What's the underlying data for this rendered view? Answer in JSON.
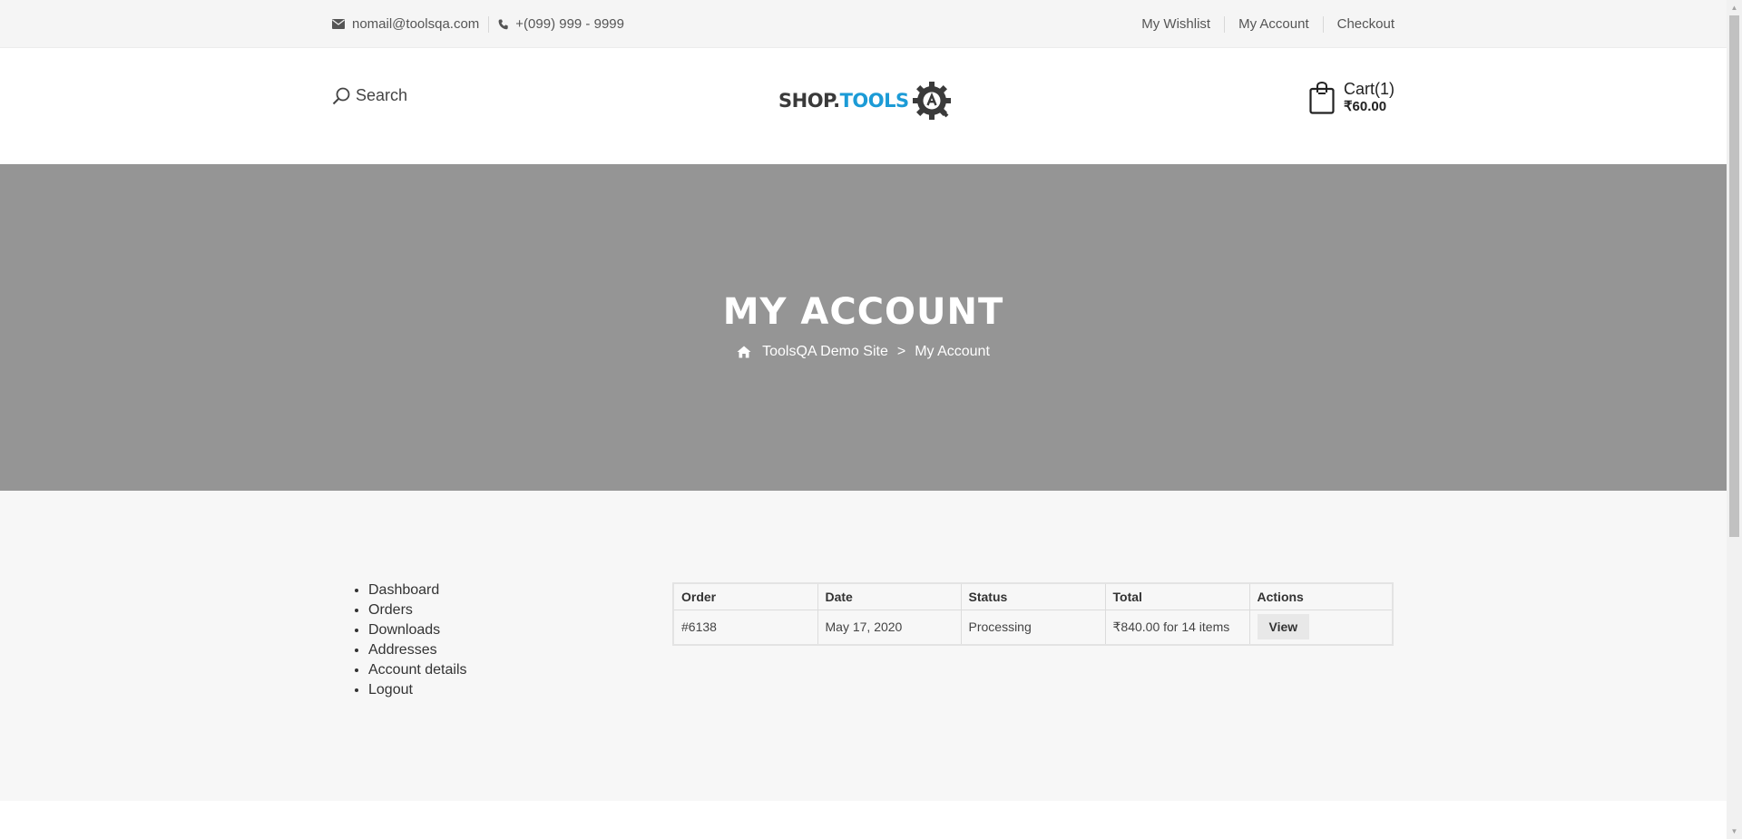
{
  "topbar": {
    "email": "nomail@toolsqa.com",
    "phone": "+(099) 999 - 9999",
    "links": [
      "My Wishlist",
      "My Account",
      "Checkout"
    ]
  },
  "header": {
    "search_label": "Search",
    "logo_shop": "SHOP.",
    "logo_tools": "TOOLS",
    "cart_label": "Cart(1)",
    "cart_total": "₹60.00"
  },
  "banner": {
    "title": "MY ACCOUNT",
    "breadcrumb_home": "ToolsQA Demo Site",
    "breadcrumb_separator": ">",
    "breadcrumb_current": "My Account"
  },
  "account_nav": [
    "Dashboard",
    "Orders",
    "Downloads",
    "Addresses",
    "Account details",
    "Logout"
  ],
  "orders_table": {
    "headers": [
      "Order",
      "Date",
      "Status",
      "Total",
      "Actions"
    ],
    "rows": [
      {
        "order": "#6138",
        "date": "May 17, 2020",
        "status": "Processing",
        "total": "₹840.00 for 14 items",
        "action": "View"
      }
    ]
  },
  "colors": {
    "banner_bg": "#959595",
    "logo_accent": "#1c9bd6",
    "topbar_bg": "#f5f5f5"
  }
}
